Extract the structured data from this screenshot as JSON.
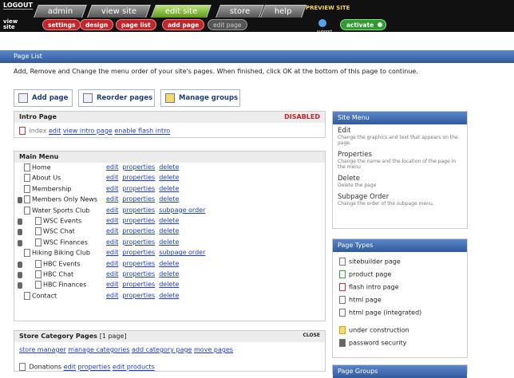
{
  "top": {
    "logout": "LOGOUT",
    "tabs": [
      "admin",
      "view site",
      "edit site",
      "store",
      "help"
    ],
    "preview": "PREVIEW SITE",
    "viewsite": [
      "view",
      "site"
    ],
    "subnav": [
      "settings",
      "design",
      "page list",
      "add page",
      "edit page"
    ],
    "support": "support",
    "activate": "activate"
  },
  "header": {
    "title": "Page List",
    "intro": "Add, Remove and Change the menu order of your site's pages. When finished, click OK at the bottom of this page to continue."
  },
  "buttons": {
    "add": "Add page",
    "reorder": "Reorder pages",
    "groups": "Manage groups"
  },
  "intro_page": {
    "title": "Intro Page",
    "status": "DISABLED",
    "index": "index",
    "links": [
      "edit",
      "view intro page",
      "enable flash intro"
    ]
  },
  "main_menu": {
    "title": "Main Menu",
    "rows": [
      {
        "name": "Home",
        "links": [
          "edit",
          "properties",
          "delete"
        ]
      },
      {
        "name": "About Us",
        "links": [
          "edit",
          "properties",
          "delete"
        ]
      },
      {
        "name": "Membership",
        "links": [
          "edit",
          "properties",
          "delete"
        ]
      },
      {
        "name": "Members Only News",
        "links": [
          "edit",
          "properties",
          "delete"
        ]
      },
      {
        "name": "Water Sports Club",
        "links": [
          "edit",
          "properties",
          "subpage order"
        ]
      },
      {
        "name": "WSC Events",
        "links": [
          "edit",
          "properties",
          "delete"
        ]
      },
      {
        "name": "WSC Chat",
        "links": [
          "edit",
          "properties",
          "delete"
        ]
      },
      {
        "name": "WSC Finances",
        "links": [
          "edit",
          "properties",
          "delete"
        ]
      },
      {
        "name": "Hiking Biking Club",
        "links": [
          "edit",
          "properties",
          "subpage order"
        ]
      },
      {
        "name": "HBC Events",
        "links": [
          "edit",
          "properties",
          "delete"
        ]
      },
      {
        "name": "HBC Chat",
        "links": [
          "edit",
          "properties",
          "delete"
        ]
      },
      {
        "name": "HBC Finances",
        "links": [
          "edit",
          "properties",
          "delete"
        ]
      },
      {
        "name": "Contact",
        "links": [
          "edit",
          "properties",
          "delete"
        ]
      }
    ]
  },
  "store": {
    "title": "Store Category Pages",
    "count": "[1 page]",
    "close": "CLOSE",
    "links": [
      "store manager",
      "manage categories",
      "add category page",
      "move pages"
    ],
    "donation": "Donations",
    "dlinks": [
      "edit",
      "properties",
      "edit products"
    ]
  },
  "site_menu": {
    "title": "Site Menu",
    "items": [
      {
        "title": "Edit",
        "desc": "Change the graphics and text that appears on the page."
      },
      {
        "title": "Properties",
        "desc": "Change the name and the location of the page in the menu"
      },
      {
        "title": "Delete",
        "desc": "Delete the page"
      },
      {
        "title": "Subpage Order",
        "desc": "Change the order of the subpage menu."
      }
    ]
  },
  "page_types": {
    "title": "Page Types",
    "items": [
      "sitebuilder page",
      "product page",
      "flash intro page",
      "html page",
      "html page (integrated)",
      "under construction",
      "password security"
    ]
  },
  "bottom_panel": {
    "title": "Page Groups"
  },
  "colors": {
    "accent": "#315a9d",
    "danger": "#c0252b"
  }
}
